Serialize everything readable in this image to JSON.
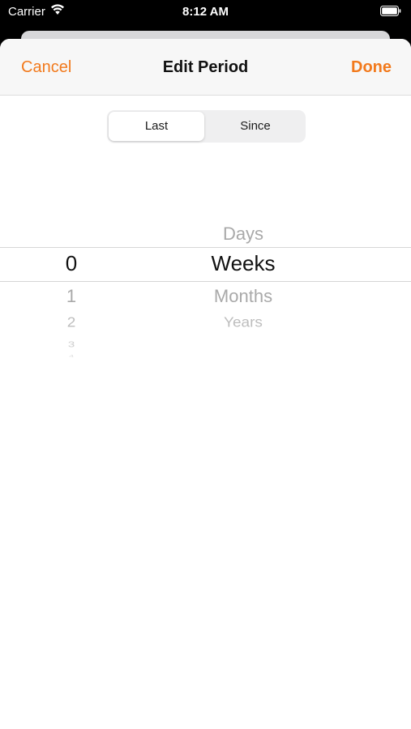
{
  "status_bar": {
    "carrier": "Carrier",
    "time": "8:12 AM",
    "icons": [
      "wifi-icon",
      "battery-icon"
    ]
  },
  "nav": {
    "cancel_label": "Cancel",
    "title": "Edit Period",
    "done_label": "Done"
  },
  "segmented": {
    "options": [
      "Last",
      "Since"
    ],
    "selected": "Last"
  },
  "picker": {
    "number_column": {
      "selected": "0",
      "below": [
        "1",
        "2",
        "3",
        "4"
      ]
    },
    "unit_column": {
      "above": [
        "Days"
      ],
      "selected": "Weeks",
      "below": [
        "Months",
        "Years"
      ]
    }
  },
  "colors": {
    "accent": "#f27a1d",
    "sheet_background": "#ffffff",
    "nav_background": "#f7f7f7"
  }
}
